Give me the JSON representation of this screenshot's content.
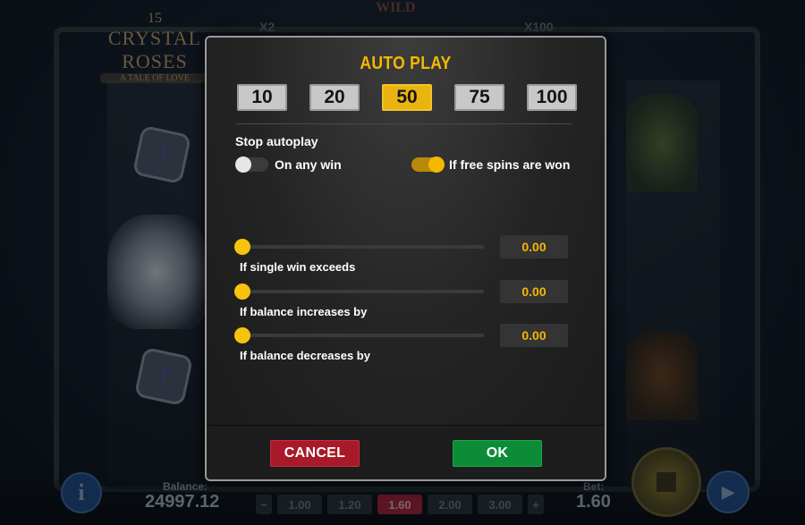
{
  "background": {
    "logo_number": "15",
    "logo_title": "CRYSTAL ROSES",
    "logo_subtitle": "A TALE OF LOVE",
    "multiplier_left": "X2",
    "multiplier_right": "X100",
    "wild_label": "WILD",
    "tile_top_letter": "J",
    "tile_bottom_letter": "T",
    "balance_label": "Balance:",
    "balance_value": "24997.12",
    "bet_label": "Bet:",
    "bet_value": "1.60",
    "bet_minus": "−",
    "bet_plus": "+",
    "bet_options": [
      "1.00",
      "1.20",
      "1.60",
      "2.00",
      "3.00"
    ],
    "bet_selected": "1.60",
    "info_icon": "info-icon",
    "spin_icon": "spin-icon",
    "autoplay_icon": "autoplay-icon"
  },
  "modal": {
    "title": "AUTO PLAY",
    "spin_counts": [
      "10",
      "20",
      "50",
      "75",
      "100"
    ],
    "selected_count": "50",
    "stop_label": "Stop autoplay",
    "toggles": [
      {
        "label": "On any win",
        "on": false
      },
      {
        "label": "If free spins are won",
        "on": true
      }
    ],
    "sliders": [
      {
        "label": "If single win exceeds",
        "value": "0.00",
        "level": 0
      },
      {
        "label": "If balance increases by",
        "value": "0.00",
        "level": 0
      },
      {
        "label": "If balance decreases by",
        "value": "0.00",
        "level": 0
      }
    ],
    "cancel_label": "CANCEL",
    "ok_label": "OK",
    "accent_color": "#f5b800",
    "cancel_color": "#a8192a",
    "ok_color": "#0d8c38"
  }
}
